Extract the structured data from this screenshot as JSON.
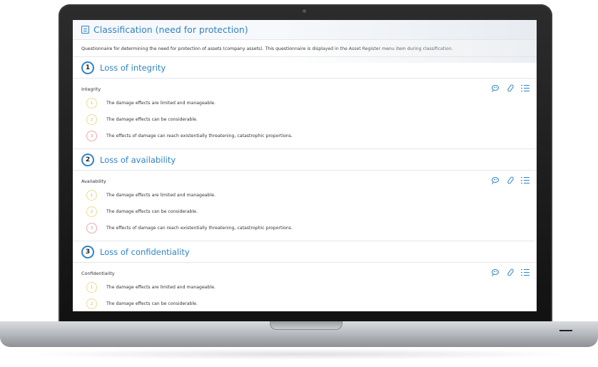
{
  "window": {
    "title": "Classification (need for protection)",
    "title_icon": "form-icon",
    "description": "Questionnaire for determining the need for protection of assets (company assets). This questionnaire is displayed in the Asset Register menu item during classification."
  },
  "colors": {
    "accent": "#2f84c6",
    "level_low": "#f0dc8a",
    "level_high": "#f2a5a5",
    "divider": "#e3e7ec"
  },
  "sections": [
    {
      "number": "1",
      "title": "Loss of integrity",
      "criterion": "Integrity",
      "options": [
        {
          "level": "1",
          "text": "The damage effects are limited and manageable."
        },
        {
          "level": "2",
          "text": "The damage effects can be considerable."
        },
        {
          "level": "3",
          "text": "The effects of damage can reach existentially threatening, catastrophic proportions."
        }
      ]
    },
    {
      "number": "2",
      "title": "Loss of availability",
      "criterion": "Availability",
      "options": [
        {
          "level": "1",
          "text": "The damage effects are limited and manageable."
        },
        {
          "level": "2",
          "text": "The damage effects can be considerable."
        },
        {
          "level": "3",
          "text": "The effects of damage can reach existentially threatening, catastrophic proportions."
        }
      ]
    },
    {
      "number": "3",
      "title": "Loss of confidentiality",
      "criterion": "Confidentiality",
      "options": [
        {
          "level": "1",
          "text": "The damage effects are limited and manageable."
        },
        {
          "level": "2",
          "text": "The damage effects can be considerable."
        }
      ]
    }
  ],
  "action_icons": [
    "comment-icon",
    "attachment-icon",
    "checklist-icon"
  ]
}
